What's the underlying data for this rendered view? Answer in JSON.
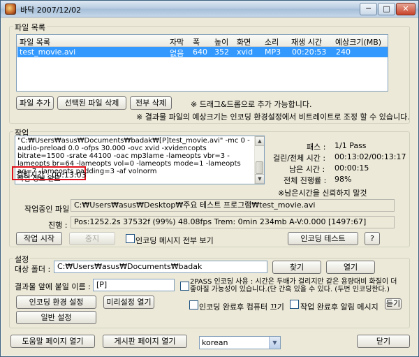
{
  "window": {
    "title": "바닥 2007/12/02",
    "min_glyph": "─",
    "max_glyph": "□",
    "close_glyph": "✕"
  },
  "file_list": {
    "group_label": "파일 목록",
    "columns": [
      "파일 목록",
      "자막",
      "폭",
      "높이",
      "화면",
      "소리",
      "재생 시간",
      "예상크기(MB)"
    ],
    "rows": [
      {
        "name": "test_movie.avi",
        "subtitle": "없음",
        "width": "640",
        "height": "352",
        "video": "xvid",
        "audio": "MP3",
        "duration": "00:20:53",
        "size": "240"
      }
    ],
    "add_label": "파일 추가",
    "remove_selected_label": "선택된 파일 삭제",
    "remove_all_label": "전부 삭제",
    "note1": "※ 드래그&드롭으로 추가 가능합니다.",
    "note2": "※ 결과물 파일의 예상크기는 인코딩 환경설정에서 비트레이트로 조정 할 수 있습니다."
  },
  "job": {
    "group_label": "작업",
    "log": "\"C:₩Users₩asus₩Documents₩badak₩[P]test_movie.avi\" -mc 0 -audio-preload 0.0 -ofps 30.000 -ovc xvid -xvidencopts bitrate=1500 -srate 44100 -oac mp3lame -lameopts vbr=3 -lameopts br=64 -lameopts vol=0 -lameopts mode=1 -lameopts aq=7 -lameopts padding=3 -af volnorm\n작업 정보 완료",
    "elapsed_line": "걸린시간 : 00:13:03",
    "pass_label": "패스 :",
    "pass_value": "1/1 Pass",
    "elapsed_total_label": "걸린/전체 시간 :",
    "elapsed_total_value": "00:13:02/00:13:17",
    "remaining_label": "남은 시간 :",
    "remaining_value": "00:00:15",
    "progress_label": "전체 진행률 :",
    "progress_value": "98%",
    "progress_fraction": 0.98,
    "warn": "※남은시간을 신뢰하지 말것",
    "current_file_label": "작업중인 파일 :",
    "current_file_value": "C:₩Users₩asus₩Desktop₩주요 테스트 프로그램₩test_movie.avi",
    "status_label": "진행 :",
    "status_value": "Pos:1252.2s  37532f (99%) 48.08fps Trem:   0min 234mb  A-V:0.000 [1497:67]",
    "start_label": "작업 시작",
    "stop_label": "중지",
    "show_all_label": "인코딩 메시지 전부 보기",
    "encode_test_label": "인코딩 테스트",
    "help_label": "?"
  },
  "settings": {
    "group_label": "설정",
    "target_folder_label": "대상 폴더 :",
    "target_folder_value": "C:₩Users₩asus₩Documents₩badak",
    "browse_label": "찾기",
    "open_label": "열기",
    "prefix_label": "결과물 앞에 붙일 이름 :",
    "prefix_value": "[P]",
    "twopass_label": "2PASS 인코딩 사용 : 시간은 두배가 걸리지만 같은 용량대비 화질이 더 좋아질 가능성이 있습니다.(단 간혹 있을 수 있다. (두번 인코딩한다.)",
    "enc_settings_label": "인코딩 환경 설정",
    "preset_open_label": "미리설정 열기",
    "shutdown_label": "인코딩 완료후 컴퓨터 끄기",
    "alarm_label": "작업 완료후 알림 메시지",
    "listen_label": "듣기",
    "general_settings_label": "일반 설정"
  },
  "footer": {
    "help_page_label": "도움말 페이지 열기",
    "board_page_label": "게시판 페이지 열기",
    "language_value": "korean",
    "close_label": "닫기"
  }
}
